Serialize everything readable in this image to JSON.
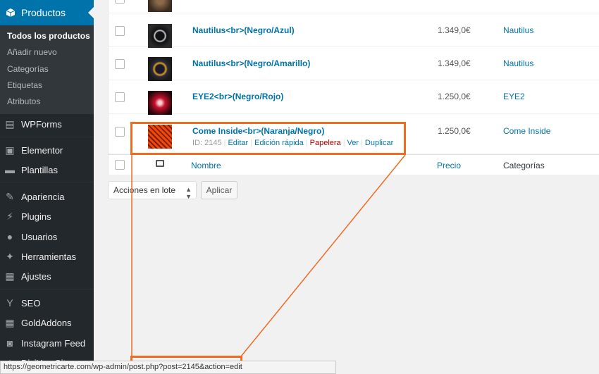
{
  "sidebar": {
    "active": "Productos",
    "submenu": [
      "Todos los productos",
      "Añadir nuevo",
      "Categorías",
      "Etiquetas",
      "Atributos"
    ],
    "items": [
      {
        "label": "WPForms",
        "icon": "wpforms-icon"
      },
      {
        "label": "Elementor",
        "icon": "elementor-icon"
      },
      {
        "label": "Plantillas",
        "icon": "folder-icon"
      },
      {
        "label": "Apariencia",
        "icon": "brush-icon"
      },
      {
        "label": "Plugins",
        "icon": "plugin-icon"
      },
      {
        "label": "Usuarios",
        "icon": "user-icon"
      },
      {
        "label": "Herramientas",
        "icon": "wrench-icon"
      },
      {
        "label": "Ajustes",
        "icon": "settings-icon"
      },
      {
        "label": "SEO",
        "icon": "yoast-icon"
      },
      {
        "label": "GoldAddons",
        "icon": "grid-icon"
      },
      {
        "label": "Instagram Feed",
        "icon": "instagram-icon"
      },
      {
        "label": "DiviYourSite",
        "icon": "divi-icon"
      }
    ]
  },
  "products": [
    {
      "name": "Nautilus<br>(Negro/Azul)",
      "price": "1.349,0€",
      "category": "Nautilus"
    },
    {
      "name": "Nautilus<br>(Negro/Amarillo)",
      "price": "1.349,0€",
      "category": "Nautilus"
    },
    {
      "name": "EYE2<br>(Negro/Rojo)",
      "price": "1.250,0€",
      "category": "EYE2"
    },
    {
      "name": "Come Inside<br>(Naranja/Negro)",
      "price": "1.250,0€",
      "category": "Come Inside",
      "row_actions": {
        "id": "ID: 2145",
        "edit": "Editar",
        "quick_edit": "Edición rápida",
        "trash": "Papelera",
        "view": "Ver",
        "duplicate": "Duplicar"
      }
    }
  ],
  "footer": {
    "name": "Nombre",
    "price": "Precio",
    "categories": "Categorías"
  },
  "bulk": {
    "select": "Acciones en lote",
    "apply": "Aplicar"
  },
  "status_url": "https://geometricarte.com/wp-admin/post.php?post=2145&action=edit",
  "colors": {
    "highlight": "#f26b21",
    "link": "#0073aa",
    "sidebar": "#23282d"
  }
}
